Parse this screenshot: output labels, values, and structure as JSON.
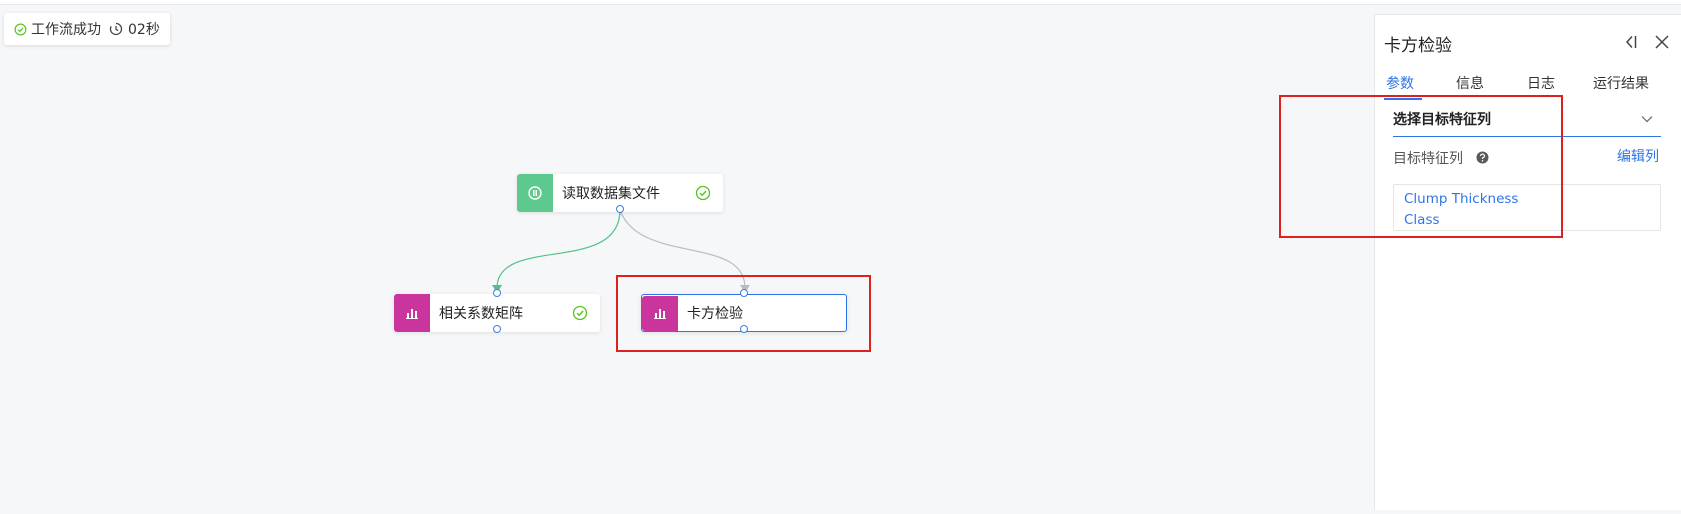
{
  "status": {
    "text": "工作流成功",
    "duration": "02秒"
  },
  "nodes": [
    {
      "label": "读取数据集文件",
      "status": "success",
      "icon": "dataset-icon",
      "color": "#5ec98e"
    },
    {
      "label": "相关系数矩阵",
      "status": "success",
      "icon": "bar-chart-icon",
      "color": "#c9359c"
    },
    {
      "label": "卡方检验",
      "status": "selected",
      "icon": "bar-chart-icon",
      "color": "#c9359c"
    }
  ],
  "panel": {
    "title": "卡方检验",
    "tabs": [
      "参数",
      "信息",
      "日志",
      "运行结果"
    ],
    "active_tab": "参数",
    "section_title": "选择目标特征列",
    "field_label": "目标特征列",
    "edit_link": "编辑列",
    "columns": [
      "Clump Thickness",
      "Class"
    ]
  },
  "colors": {
    "accent": "#2f74e8",
    "success": "#52c41a",
    "highlight": "#e02020"
  }
}
